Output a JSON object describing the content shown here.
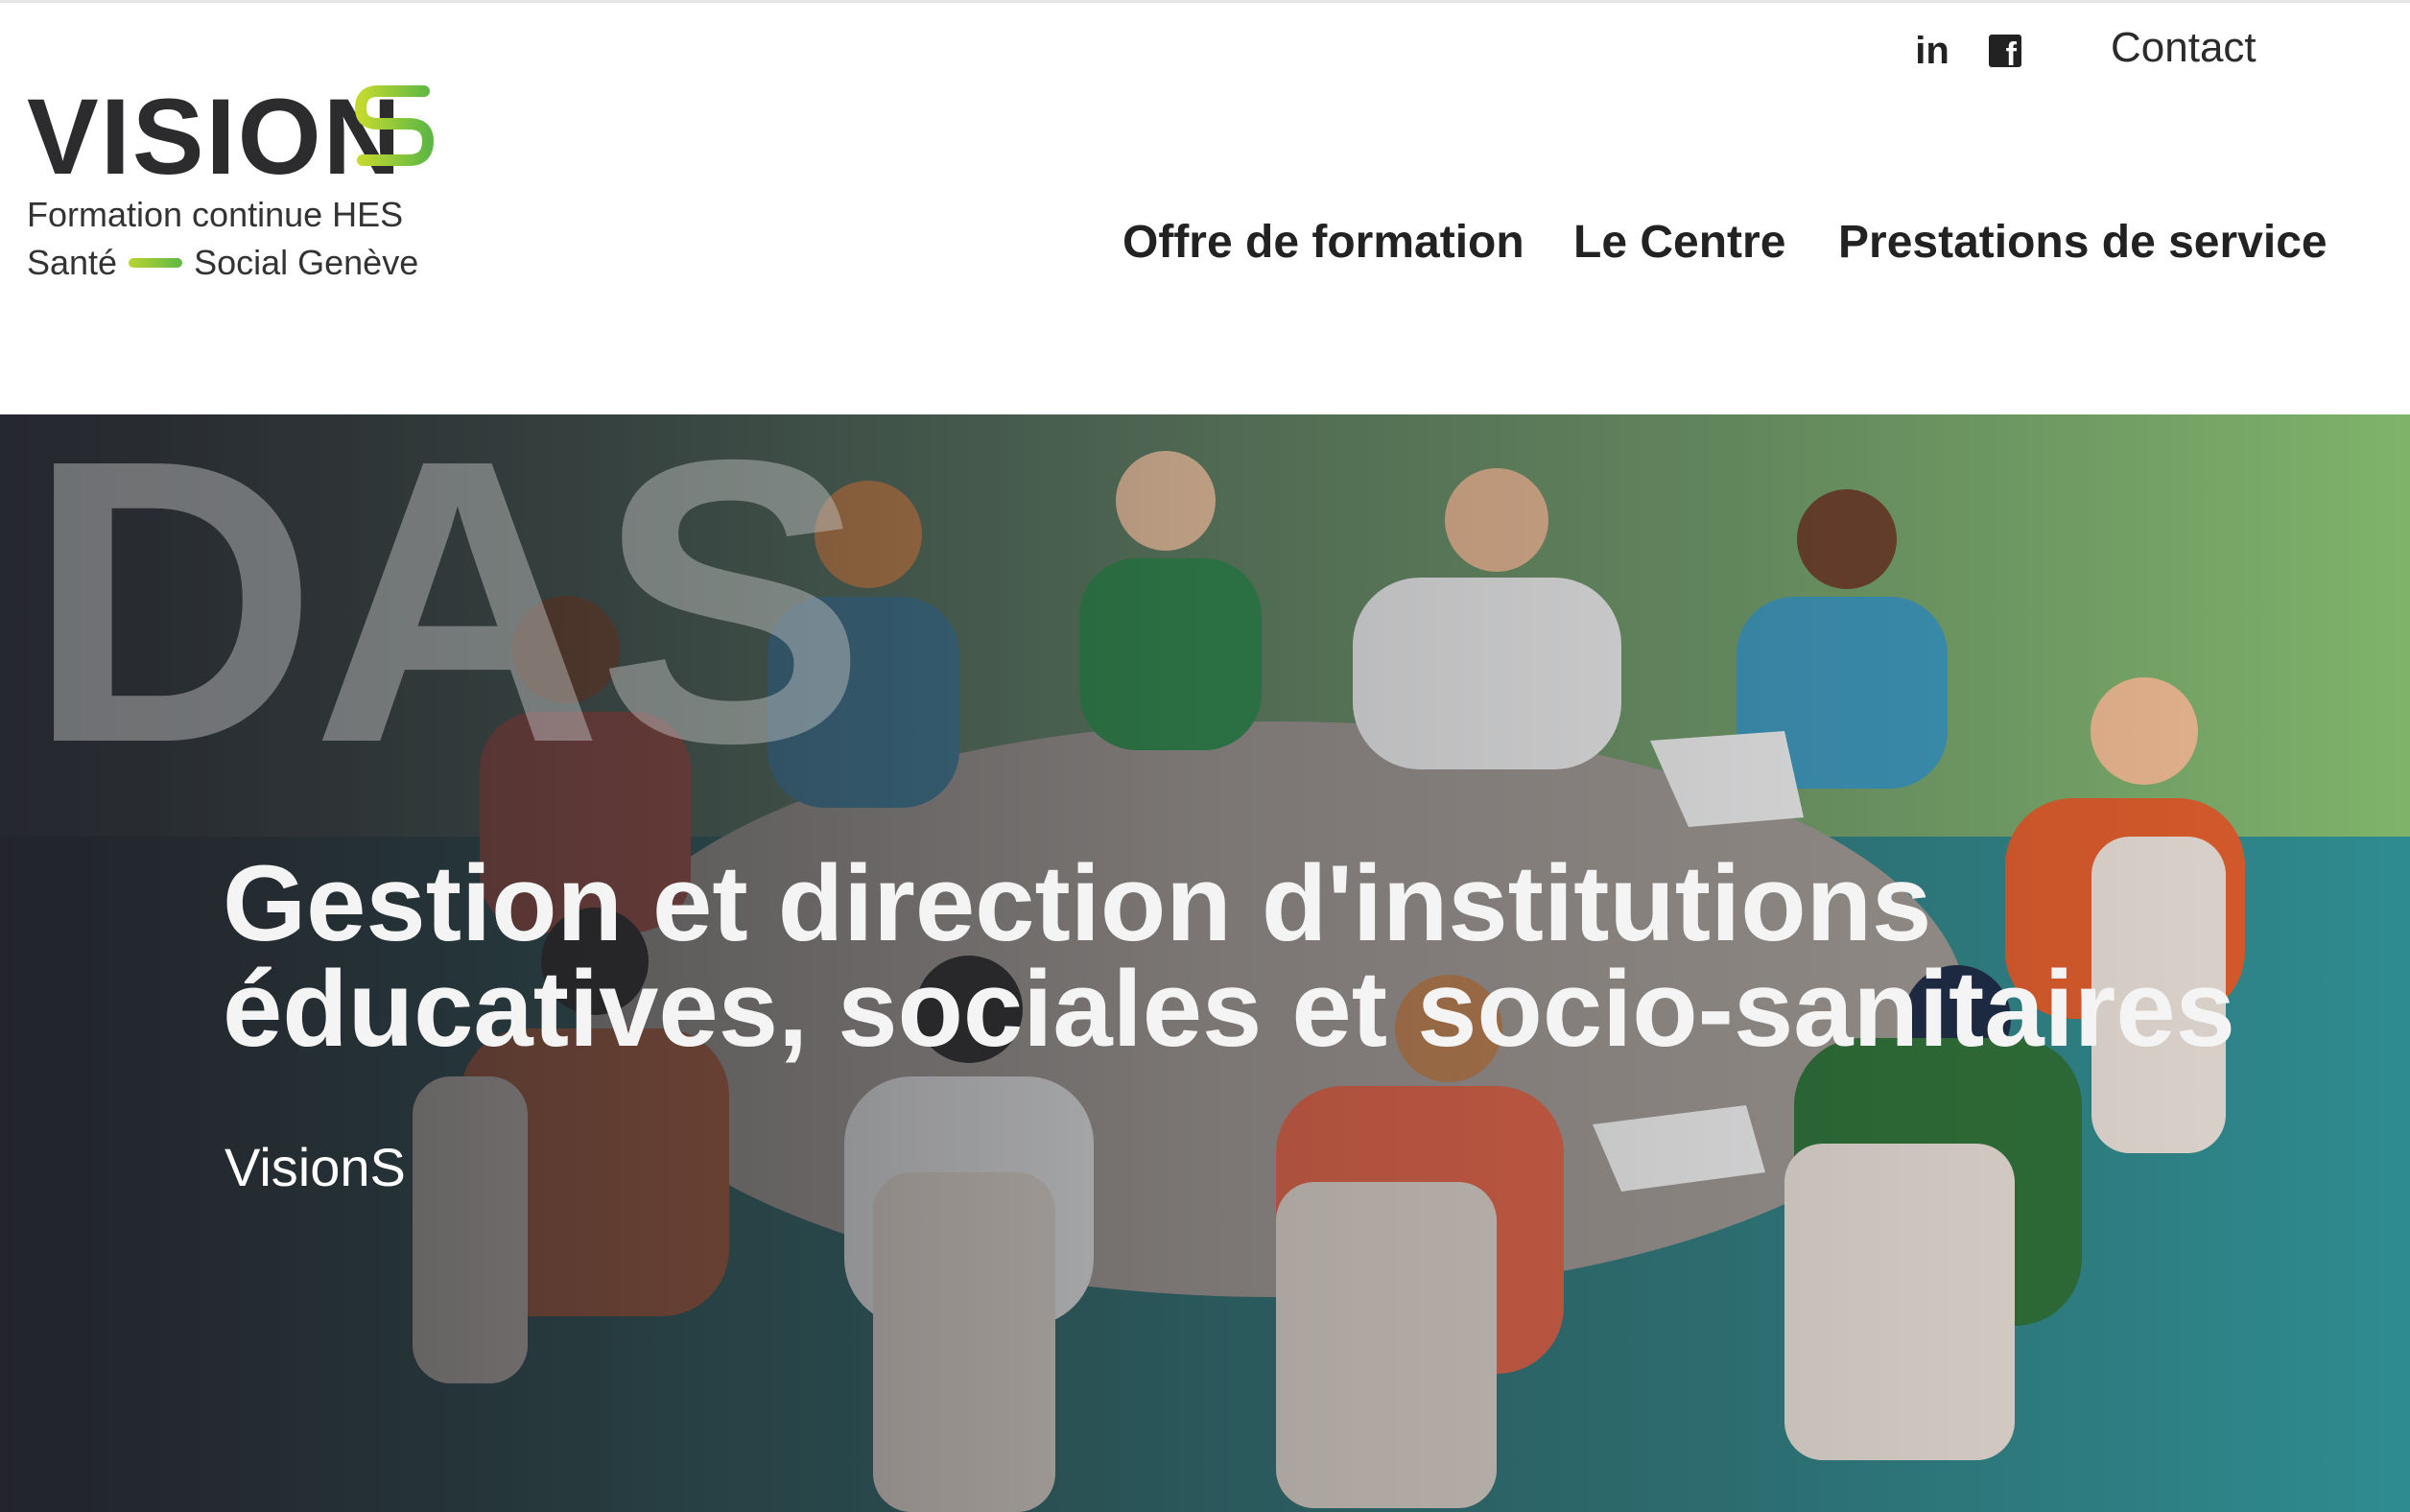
{
  "logo": {
    "wordmark": "VISION",
    "line1": "Formation continue HES",
    "line2_left": "Santé",
    "line2_right": "Social Genève"
  },
  "social": {
    "linkedin_icon": "linkedin-icon",
    "linkedin_label": "in",
    "facebook_icon": "facebook-icon",
    "facebook_label": "f"
  },
  "header": {
    "contact": "Contact",
    "nav": [
      "Offre de formation",
      "Le Centre",
      "Prestations de service"
    ]
  },
  "hero": {
    "background_word": "DAS",
    "title_line1": "Gestion et direction d'institutions",
    "title_line2": "éducatives, sociales et socio-sanitaires",
    "subtitle": "VisionS"
  },
  "colors": {
    "brand_green_light": "#b9d334",
    "brand_green": "#5fb843",
    "text_dark": "#222222",
    "hero_overlay_dark": "#2c3038",
    "hero_teal": "#2f8a8a"
  }
}
